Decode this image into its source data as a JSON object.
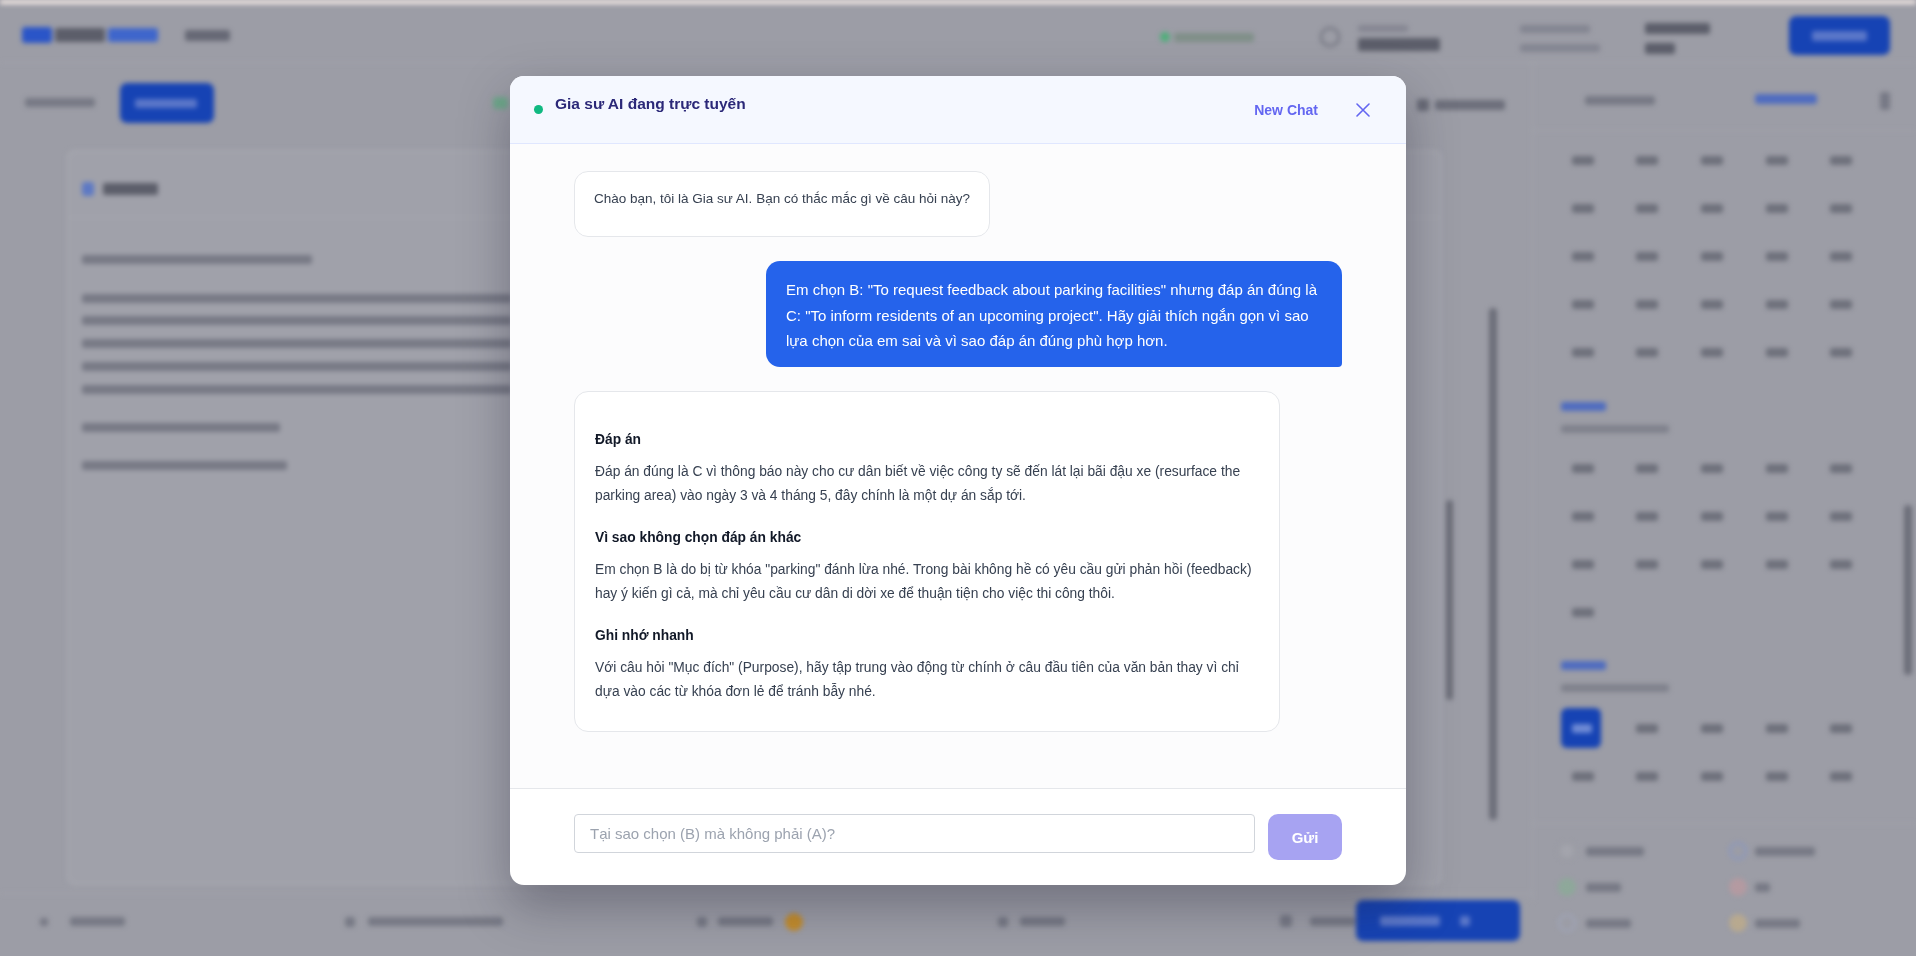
{
  "chat": {
    "status": {
      "online": true,
      "title": "Gia sư AI đang trực tuyến"
    },
    "new_chat_label": "New Chat",
    "messages": [
      {
        "kind": "assistant",
        "text": "Chào bạn, tôi là Gia sư AI. Bạn có thắc mắc gì về câu hỏi này?"
      },
      {
        "kind": "user",
        "text": "Em chọn B: \"To request feedback about parking facilities\" nhưng đáp án đúng là C: \"To inform residents of an upcoming project\". Hãy giải thích ngắn gọn vì sao lựa chọn của em sai và vì sao đáp án đúng phù hợp hơn."
      },
      {
        "kind": "assistant",
        "sections": [
          {
            "heading": "Đáp án",
            "body": "Đáp án đúng là C vì thông báo này cho cư dân biết về việc công ty sẽ đến lát lại bãi đậu xe (resurface the parking area) vào ngày 3 và 4 tháng 5, đây chính là một dự án sắp tới."
          },
          {
            "heading": "Vì sao không chọn đáp án khác",
            "body": "Em chọn B là do bị từ khóa \"parking\" đánh lừa nhé. Trong bài không hề có yêu cầu gửi phản hồi (feedback) hay ý kiến gì cả, mà chỉ yêu cầu cư dân di dời xe để thuận tiện cho việc thi công thôi."
          },
          {
            "heading": "Ghi nhớ nhanh",
            "body": "Với câu hỏi \"Mục đích\" (Purpose), hãy tập trung vào động từ chính ở câu đầu tiên của văn bản thay vì chỉ dựa vào các từ khóa đơn lẻ để tránh bẫy nhé."
          }
        ]
      }
    ],
    "input": {
      "placeholder": "Tại sao chọn (B) mà không phải (A)?"
    },
    "send_button": {
      "label": "Gửi",
      "disabled": true
    }
  }
}
